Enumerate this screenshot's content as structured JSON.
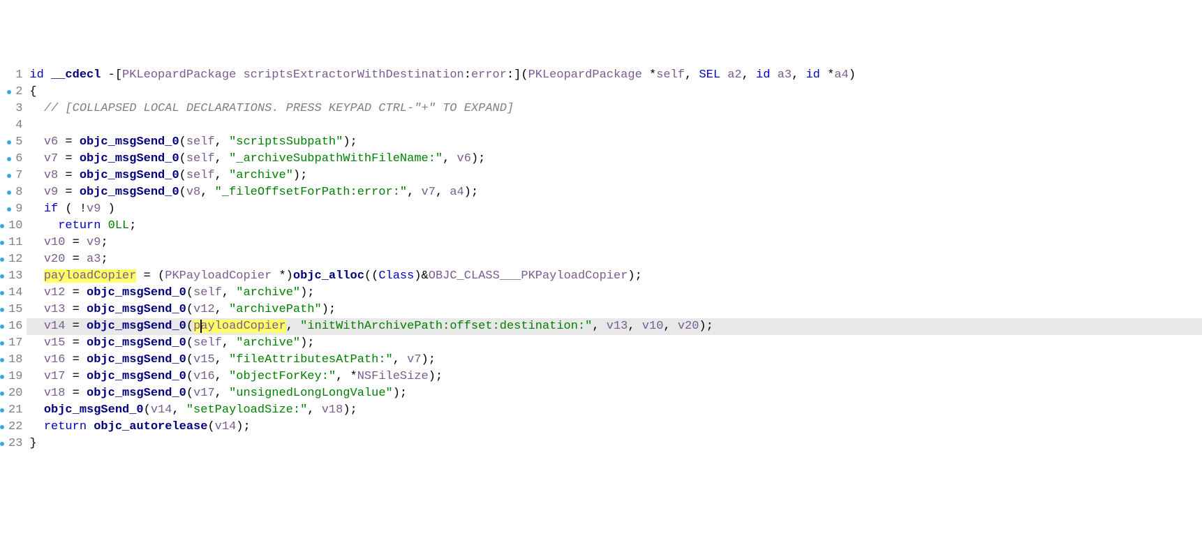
{
  "lines": [
    {
      "n": 1,
      "dot": false,
      "current": false,
      "segments": [
        {
          "c": "kw",
          "t": "id "
        },
        {
          "c": "fn",
          "t": "__cdecl "
        },
        {
          "c": "op",
          "t": "-["
        },
        {
          "c": "var",
          "t": "PKLeopardPackage scriptsExtractorWithDestination"
        },
        {
          "c": "op",
          "t": ":"
        },
        {
          "c": "var",
          "t": "error"
        },
        {
          "c": "op",
          "t": ":]("
        },
        {
          "c": "var",
          "t": "PKLeopardPackage"
        },
        {
          "c": "op",
          "t": " *"
        },
        {
          "c": "var",
          "t": "self"
        },
        {
          "c": "op",
          "t": ", "
        },
        {
          "c": "kw",
          "t": "SEL "
        },
        {
          "c": "var",
          "t": "a2"
        },
        {
          "c": "op",
          "t": ", "
        },
        {
          "c": "kw",
          "t": "id "
        },
        {
          "c": "var",
          "t": "a3"
        },
        {
          "c": "op",
          "t": ", "
        },
        {
          "c": "kw",
          "t": "id "
        },
        {
          "c": "op",
          "t": "*"
        },
        {
          "c": "var",
          "t": "a4"
        },
        {
          "c": "op",
          "t": ")"
        }
      ]
    },
    {
      "n": 2,
      "dot": true,
      "current": false,
      "segments": [
        {
          "c": "punct",
          "t": "{"
        }
      ]
    },
    {
      "n": 3,
      "dot": false,
      "current": false,
      "segments": [
        {
          "c": "punct",
          "t": "  "
        },
        {
          "c": "cmt",
          "t": "// [COLLAPSED LOCAL DECLARATIONS. PRESS KEYPAD CTRL-\"+\" TO EXPAND]"
        }
      ]
    },
    {
      "n": 4,
      "dot": false,
      "current": false,
      "segments": []
    },
    {
      "n": 5,
      "dot": true,
      "current": false,
      "segments": [
        {
          "c": "punct",
          "t": "  "
        },
        {
          "c": "var",
          "t": "v6"
        },
        {
          "c": "op",
          "t": " = "
        },
        {
          "c": "fn",
          "t": "objc_msgSend_0"
        },
        {
          "c": "op",
          "t": "("
        },
        {
          "c": "var",
          "t": "self"
        },
        {
          "c": "op",
          "t": ", "
        },
        {
          "c": "str",
          "t": "\"scriptsSubpath\""
        },
        {
          "c": "op",
          "t": ");"
        }
      ]
    },
    {
      "n": 6,
      "dot": true,
      "current": false,
      "segments": [
        {
          "c": "punct",
          "t": "  "
        },
        {
          "c": "var",
          "t": "v7"
        },
        {
          "c": "op",
          "t": " = "
        },
        {
          "c": "fn",
          "t": "objc_msgSend_0"
        },
        {
          "c": "op",
          "t": "("
        },
        {
          "c": "var",
          "t": "self"
        },
        {
          "c": "op",
          "t": ", "
        },
        {
          "c": "str",
          "t": "\"_archiveSubpathWithFileName:\""
        },
        {
          "c": "op",
          "t": ", "
        },
        {
          "c": "var",
          "t": "v6"
        },
        {
          "c": "op",
          "t": ");"
        }
      ]
    },
    {
      "n": 7,
      "dot": true,
      "current": false,
      "segments": [
        {
          "c": "punct",
          "t": "  "
        },
        {
          "c": "var",
          "t": "v8"
        },
        {
          "c": "op",
          "t": " = "
        },
        {
          "c": "fn",
          "t": "objc_msgSend_0"
        },
        {
          "c": "op",
          "t": "("
        },
        {
          "c": "var",
          "t": "self"
        },
        {
          "c": "op",
          "t": ", "
        },
        {
          "c": "str",
          "t": "\"archive\""
        },
        {
          "c": "op",
          "t": ");"
        }
      ]
    },
    {
      "n": 8,
      "dot": true,
      "current": false,
      "segments": [
        {
          "c": "punct",
          "t": "  "
        },
        {
          "c": "var",
          "t": "v9"
        },
        {
          "c": "op",
          "t": " = "
        },
        {
          "c": "fn",
          "t": "objc_msgSend_0"
        },
        {
          "c": "op",
          "t": "("
        },
        {
          "c": "var",
          "t": "v8"
        },
        {
          "c": "op",
          "t": ", "
        },
        {
          "c": "str",
          "t": "\"_fileOffsetForPath:error:\""
        },
        {
          "c": "op",
          "t": ", "
        },
        {
          "c": "var",
          "t": "v7"
        },
        {
          "c": "op",
          "t": ", "
        },
        {
          "c": "var",
          "t": "a4"
        },
        {
          "c": "op",
          "t": ");"
        }
      ]
    },
    {
      "n": 9,
      "dot": true,
      "current": false,
      "segments": [
        {
          "c": "punct",
          "t": "  "
        },
        {
          "c": "kw",
          "t": "if"
        },
        {
          "c": "op",
          "t": " ( !"
        },
        {
          "c": "var",
          "t": "v9"
        },
        {
          "c": "op",
          "t": " )"
        }
      ]
    },
    {
      "n": 10,
      "dot": true,
      "current": false,
      "segments": [
        {
          "c": "punct",
          "t": "    "
        },
        {
          "c": "kw",
          "t": "return"
        },
        {
          "c": "op",
          "t": " "
        },
        {
          "c": "num",
          "t": "0LL"
        },
        {
          "c": "op",
          "t": ";"
        }
      ]
    },
    {
      "n": 11,
      "dot": true,
      "current": false,
      "segments": [
        {
          "c": "punct",
          "t": "  "
        },
        {
          "c": "var",
          "t": "v10"
        },
        {
          "c": "op",
          "t": " = "
        },
        {
          "c": "var",
          "t": "v9"
        },
        {
          "c": "op",
          "t": ";"
        }
      ]
    },
    {
      "n": 12,
      "dot": true,
      "current": false,
      "segments": [
        {
          "c": "punct",
          "t": "  "
        },
        {
          "c": "var",
          "t": "v20"
        },
        {
          "c": "op",
          "t": " = "
        },
        {
          "c": "var",
          "t": "a3"
        },
        {
          "c": "op",
          "t": ";"
        }
      ]
    },
    {
      "n": 13,
      "dot": true,
      "current": false,
      "segments": [
        {
          "c": "punct",
          "t": "  "
        },
        {
          "c": "var hl",
          "t": "payloadCopier"
        },
        {
          "c": "op",
          "t": " = ("
        },
        {
          "c": "var",
          "t": "PKPayloadCopier"
        },
        {
          "c": "op",
          "t": " *)"
        },
        {
          "c": "fn",
          "t": "objc_alloc"
        },
        {
          "c": "op",
          "t": "(("
        },
        {
          "c": "kw",
          "t": "Class"
        },
        {
          "c": "op",
          "t": ")&"
        },
        {
          "c": "var",
          "t": "OBJC_CLASS___PKPayloadCopier"
        },
        {
          "c": "op",
          "t": ");"
        }
      ]
    },
    {
      "n": 14,
      "dot": true,
      "current": false,
      "segments": [
        {
          "c": "punct",
          "t": "  "
        },
        {
          "c": "var",
          "t": "v12"
        },
        {
          "c": "op",
          "t": " = "
        },
        {
          "c": "fn",
          "t": "objc_msgSend_0"
        },
        {
          "c": "op",
          "t": "("
        },
        {
          "c": "var",
          "t": "self"
        },
        {
          "c": "op",
          "t": ", "
        },
        {
          "c": "str",
          "t": "\"archive\""
        },
        {
          "c": "op",
          "t": ");"
        }
      ]
    },
    {
      "n": 15,
      "dot": true,
      "current": false,
      "segments": [
        {
          "c": "punct",
          "t": "  "
        },
        {
          "c": "var",
          "t": "v13"
        },
        {
          "c": "op",
          "t": " = "
        },
        {
          "c": "fn",
          "t": "objc_msgSend_0"
        },
        {
          "c": "op",
          "t": "("
        },
        {
          "c": "var",
          "t": "v12"
        },
        {
          "c": "op",
          "t": ", "
        },
        {
          "c": "str",
          "t": "\"archivePath\""
        },
        {
          "c": "op",
          "t": ");"
        }
      ]
    },
    {
      "n": 16,
      "dot": true,
      "current": true,
      "segments": [
        {
          "c": "punct",
          "t": "  "
        },
        {
          "c": "var",
          "t": "v14"
        },
        {
          "c": "op",
          "t": " = "
        },
        {
          "c": "fn",
          "t": "objc_msgSend_0"
        },
        {
          "c": "op",
          "t": "("
        },
        {
          "c": "var hl",
          "t": "p"
        },
        {
          "c": "var caret",
          "t": "a"
        },
        {
          "c": "var hl",
          "t": "yloadCopier"
        },
        {
          "c": "op",
          "t": ", "
        },
        {
          "c": "str",
          "t": "\"initWithArchivePath:offset:destination:\""
        },
        {
          "c": "op",
          "t": ", "
        },
        {
          "c": "var",
          "t": "v13"
        },
        {
          "c": "op",
          "t": ", "
        },
        {
          "c": "var",
          "t": "v10"
        },
        {
          "c": "op",
          "t": ", "
        },
        {
          "c": "var",
          "t": "v20"
        },
        {
          "c": "op",
          "t": ");"
        }
      ]
    },
    {
      "n": 17,
      "dot": true,
      "current": false,
      "segments": [
        {
          "c": "punct",
          "t": "  "
        },
        {
          "c": "var",
          "t": "v15"
        },
        {
          "c": "op",
          "t": " = "
        },
        {
          "c": "fn",
          "t": "objc_msgSend_0"
        },
        {
          "c": "op",
          "t": "("
        },
        {
          "c": "var",
          "t": "self"
        },
        {
          "c": "op",
          "t": ", "
        },
        {
          "c": "str",
          "t": "\"archive\""
        },
        {
          "c": "op",
          "t": ");"
        }
      ]
    },
    {
      "n": 18,
      "dot": true,
      "current": false,
      "segments": [
        {
          "c": "punct",
          "t": "  "
        },
        {
          "c": "var",
          "t": "v16"
        },
        {
          "c": "op",
          "t": " = "
        },
        {
          "c": "fn",
          "t": "objc_msgSend_0"
        },
        {
          "c": "op",
          "t": "("
        },
        {
          "c": "var",
          "t": "v15"
        },
        {
          "c": "op",
          "t": ", "
        },
        {
          "c": "str",
          "t": "\"fileAttributesAtPath:\""
        },
        {
          "c": "op",
          "t": ", "
        },
        {
          "c": "var",
          "t": "v7"
        },
        {
          "c": "op",
          "t": ");"
        }
      ]
    },
    {
      "n": 19,
      "dot": true,
      "current": false,
      "segments": [
        {
          "c": "punct",
          "t": "  "
        },
        {
          "c": "var",
          "t": "v17"
        },
        {
          "c": "op",
          "t": " = "
        },
        {
          "c": "fn",
          "t": "objc_msgSend_0"
        },
        {
          "c": "op",
          "t": "("
        },
        {
          "c": "var",
          "t": "v16"
        },
        {
          "c": "op",
          "t": ", "
        },
        {
          "c": "str",
          "t": "\"objectForKey:\""
        },
        {
          "c": "op",
          "t": ", *"
        },
        {
          "c": "var",
          "t": "NSFileSize"
        },
        {
          "c": "op",
          "t": ");"
        }
      ]
    },
    {
      "n": 20,
      "dot": true,
      "current": false,
      "segments": [
        {
          "c": "punct",
          "t": "  "
        },
        {
          "c": "var",
          "t": "v18"
        },
        {
          "c": "op",
          "t": " = "
        },
        {
          "c": "fn",
          "t": "objc_msgSend_0"
        },
        {
          "c": "op",
          "t": "("
        },
        {
          "c": "var",
          "t": "v17"
        },
        {
          "c": "op",
          "t": ", "
        },
        {
          "c": "str",
          "t": "\"unsignedLongLongValue\""
        },
        {
          "c": "op",
          "t": ");"
        }
      ]
    },
    {
      "n": 21,
      "dot": true,
      "current": false,
      "segments": [
        {
          "c": "punct",
          "t": "  "
        },
        {
          "c": "fn",
          "t": "objc_msgSend_0"
        },
        {
          "c": "op",
          "t": "("
        },
        {
          "c": "var",
          "t": "v14"
        },
        {
          "c": "op",
          "t": ", "
        },
        {
          "c": "str",
          "t": "\"setPayloadSize:\""
        },
        {
          "c": "op",
          "t": ", "
        },
        {
          "c": "var",
          "t": "v18"
        },
        {
          "c": "op",
          "t": ");"
        }
      ]
    },
    {
      "n": 22,
      "dot": true,
      "current": false,
      "segments": [
        {
          "c": "punct",
          "t": "  "
        },
        {
          "c": "kw",
          "t": "return"
        },
        {
          "c": "op",
          "t": " "
        },
        {
          "c": "fn",
          "t": "objc_autorelease"
        },
        {
          "c": "op",
          "t": "("
        },
        {
          "c": "var",
          "t": "v14"
        },
        {
          "c": "op",
          "t": ");"
        }
      ]
    },
    {
      "n": 23,
      "dot": true,
      "current": false,
      "segments": [
        {
          "c": "punct",
          "t": "}"
        }
      ]
    }
  ]
}
